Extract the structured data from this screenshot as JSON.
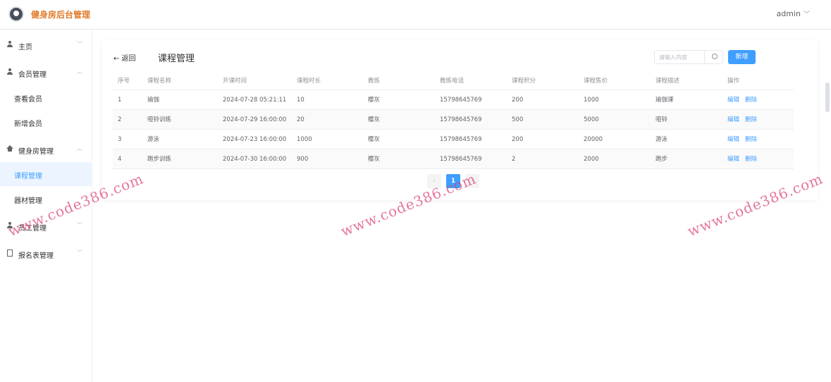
{
  "app": {
    "title": "健身房后台管理",
    "user": "admin"
  },
  "sidebar": {
    "items": [
      {
        "label": "主页",
        "icon": "person-icon"
      },
      {
        "label": "会员管理",
        "icon": "person-icon"
      },
      {
        "label": "查看会员"
      },
      {
        "label": "新增会员"
      },
      {
        "label": "健身房管理",
        "icon": "home-icon"
      },
      {
        "label": "课程管理",
        "active": true
      },
      {
        "label": "器材管理"
      },
      {
        "label": "员工管理",
        "icon": "person-icon"
      },
      {
        "label": "报名表管理",
        "icon": "document-icon"
      }
    ]
  },
  "main": {
    "back_label": "返回",
    "page_title": "课程管理",
    "search_placeholder": "请输入内容",
    "add_label": "新增",
    "columns": [
      "序号",
      "课程名称",
      "开课时间",
      "课程时长",
      "教练",
      "教练电话",
      "课程积分",
      "课程售价",
      "课程描述",
      "操作"
    ],
    "rows": [
      [
        "1",
        "瑜伽",
        "2024-07-28 05:21:11",
        "10",
        "樱灰",
        "15798645769",
        "200",
        "1000",
        "瑜伽课"
      ],
      [
        "2",
        "哑铃训练",
        "2024-07-29 16:00:00",
        "20",
        "樱灰",
        "15798645769",
        "500",
        "5000",
        "哑铃"
      ],
      [
        "3",
        "游泳",
        "2024-07-23 16:00:00",
        "1000",
        "樱灰",
        "15798645769",
        "200",
        "20000",
        "游泳"
      ],
      [
        "4",
        "跑步训练",
        "2024-07-30 16:00:00",
        "900",
        "樱灰",
        "15798645769",
        "2",
        "2000",
        "跑步"
      ]
    ],
    "row_actions": {
      "edit": "编辑",
      "delete": "删除"
    },
    "pager": {
      "prev": "‹",
      "current": "1",
      "next": "›"
    }
  },
  "watermark": "www.code386.com",
  "colors": {
    "accent": "#409eff",
    "brand": "#e07a2a"
  }
}
